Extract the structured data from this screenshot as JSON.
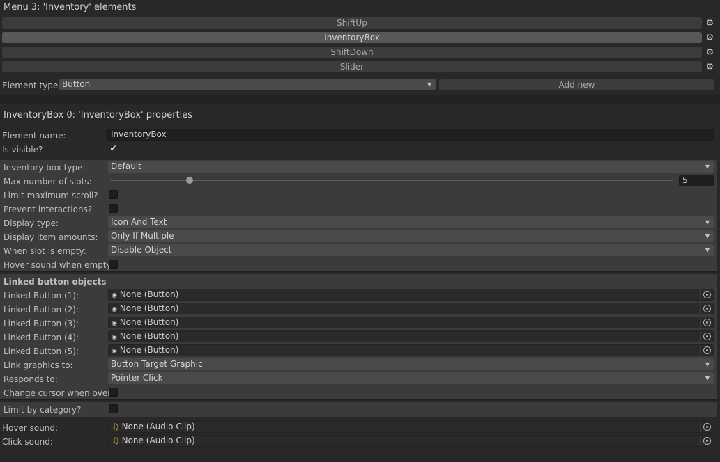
{
  "menu_title": "Menu 3: 'Inventory' elements",
  "elements": [
    {
      "label": "ShiftUp",
      "selected": false
    },
    {
      "label": "InventoryBox",
      "selected": true
    },
    {
      "label": "ShiftDown",
      "selected": false
    },
    {
      "label": "Slider",
      "selected": false
    }
  ],
  "gear_icon": "⚙",
  "element_type": {
    "label": "Element type:",
    "value": "Button",
    "add_label": "Add new"
  },
  "props_title": "InventoryBox 0: 'InventoryBox' properties",
  "element_name": {
    "label": "Element name:",
    "value": "InventoryBox"
  },
  "is_visible": {
    "label": "Is visible?",
    "checked": true,
    "check_glyph": "✔"
  },
  "inventory": {
    "box_type": {
      "label": "Inventory box type:",
      "value": "Default"
    },
    "max_slots": {
      "label": "Max number of slots:",
      "value": "5",
      "slider_fraction": 0.14
    },
    "limit_scroll": {
      "label": "Limit maximum scroll?",
      "checked": false
    },
    "prevent_interactions": {
      "label": "Prevent interactions?",
      "checked": false
    },
    "display_type": {
      "label": "Display type:",
      "value": "Icon And Text"
    },
    "display_amounts": {
      "label": "Display item amounts:",
      "value": "Only If Multiple"
    },
    "when_empty": {
      "label": "When slot is empty:",
      "value": "Disable Object"
    },
    "hover_sound_empty": {
      "label": "Hover sound when empty?",
      "checked": false
    }
  },
  "linked": {
    "header": "Linked button objects",
    "buttons": [
      {
        "label": "Linked Button (1):",
        "value": "None (Button)"
      },
      {
        "label": "Linked Button (2):",
        "value": "None (Button)"
      },
      {
        "label": "Linked Button (3):",
        "value": "None (Button)"
      },
      {
        "label": "Linked Button (4):",
        "value": "None (Button)"
      },
      {
        "label": "Linked Button (5):",
        "value": "None (Button)"
      }
    ],
    "object_icon": "◉",
    "link_graphics": {
      "label": "Link graphics to:",
      "value": "Button Target Graphic"
    },
    "responds_to": {
      "label": "Responds to:",
      "value": "Pointer Click"
    },
    "change_cursor": {
      "label": "Change cursor when over?",
      "checked": false
    }
  },
  "limit_category": {
    "label": "Limit by category?",
    "checked": false
  },
  "sounds": {
    "audio_icon": "♫",
    "hover": {
      "label": "Hover sound:",
      "value": "None (Audio Clip)"
    },
    "click": {
      "label": "Click sound:",
      "value": "None (Audio Clip)"
    }
  },
  "colors": {
    "background": "#282828",
    "panel": "#3b3b3b",
    "audio_icon": "#e8b923"
  }
}
